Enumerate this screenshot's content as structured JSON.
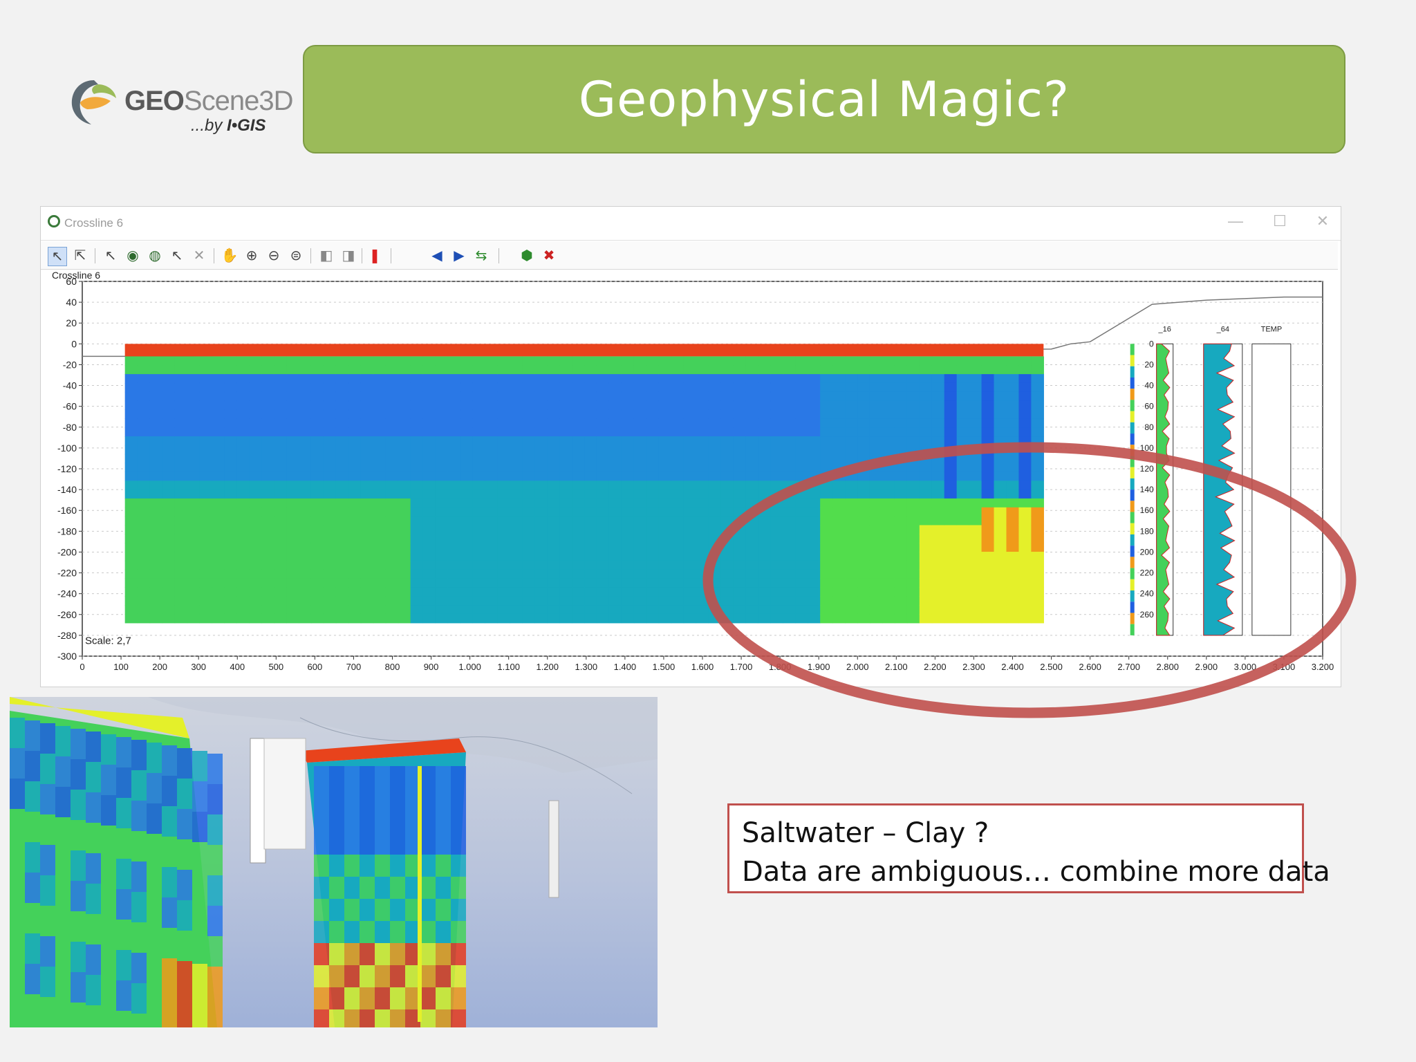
{
  "logo": {
    "brand_bold": "GEO",
    "brand_light": "Scene3D",
    "byline_prefix": "...by ",
    "byline_brand": "I•GIS"
  },
  "slide": {
    "title": "Geophysical Magic?"
  },
  "window": {
    "title": "Crossline 6",
    "controls": {
      "minimize": "—",
      "maximize": "☐",
      "close": "✕"
    }
  },
  "toolbar": {
    "icons": [
      "select-arrow-icon",
      "select-text-icon",
      "pick-icon",
      "globe-edit-icon",
      "globe-add-icon",
      "pick-delete-icon",
      "cross-icon",
      "pan-hand-icon",
      "zoom-in-icon",
      "zoom-out-icon",
      "zoom-extent-icon",
      "back-icon",
      "forward-icon",
      "red-marker-icon",
      "prev-icon",
      "next-icon",
      "refresh-icon",
      "export-icon",
      "close-red-icon"
    ]
  },
  "chart_data": {
    "type": "heatmap",
    "title": "Crossline 6",
    "scale_label": "Scale: 2,7",
    "x_ticks": [
      "0",
      "100",
      "200",
      "300",
      "400",
      "500",
      "600",
      "700",
      "800",
      "900",
      "1.000",
      "1.100",
      "1.200",
      "1.300",
      "1.400",
      "1.500",
      "1.600",
      "1.700",
      "1.800",
      "1.900",
      "2.000",
      "2.100",
      "2.200",
      "2.300",
      "2.400",
      "2.500",
      "2.600",
      "2.700",
      "2.800",
      "2.900",
      "3.000",
      "3.100",
      "3.200"
    ],
    "y_ticks": [
      "60",
      "40",
      "20",
      "0",
      "-20",
      "-40",
      "-60",
      "-80",
      "-100",
      "-120",
      "-140",
      "-160",
      "-180",
      "-200",
      "-220",
      "-240",
      "-260",
      "-280",
      "-300"
    ],
    "ylim": [
      -300,
      60
    ],
    "xlim": [
      0,
      3200
    ],
    "well_logs": {
      "names": [
        "_16",
        "_64",
        "TEMP"
      ],
      "depth_ticks": [
        "0",
        "20",
        "40",
        "60",
        "80",
        "100",
        "120",
        "140",
        "160",
        "180",
        "200",
        "220",
        "240",
        "260"
      ]
    },
    "colors": {
      "surface": "#e8431c",
      "blue": "#1f5fe0",
      "cyan": "#17a9bf",
      "green": "#44d15a",
      "yellow": "#e4f02a",
      "orange": "#f09a1a"
    }
  },
  "annotation": {
    "line1": "Saltwater – Clay ?",
    "line2": "Data are ambiguous… combine more data"
  },
  "ellipse_color": "#c0504d"
}
